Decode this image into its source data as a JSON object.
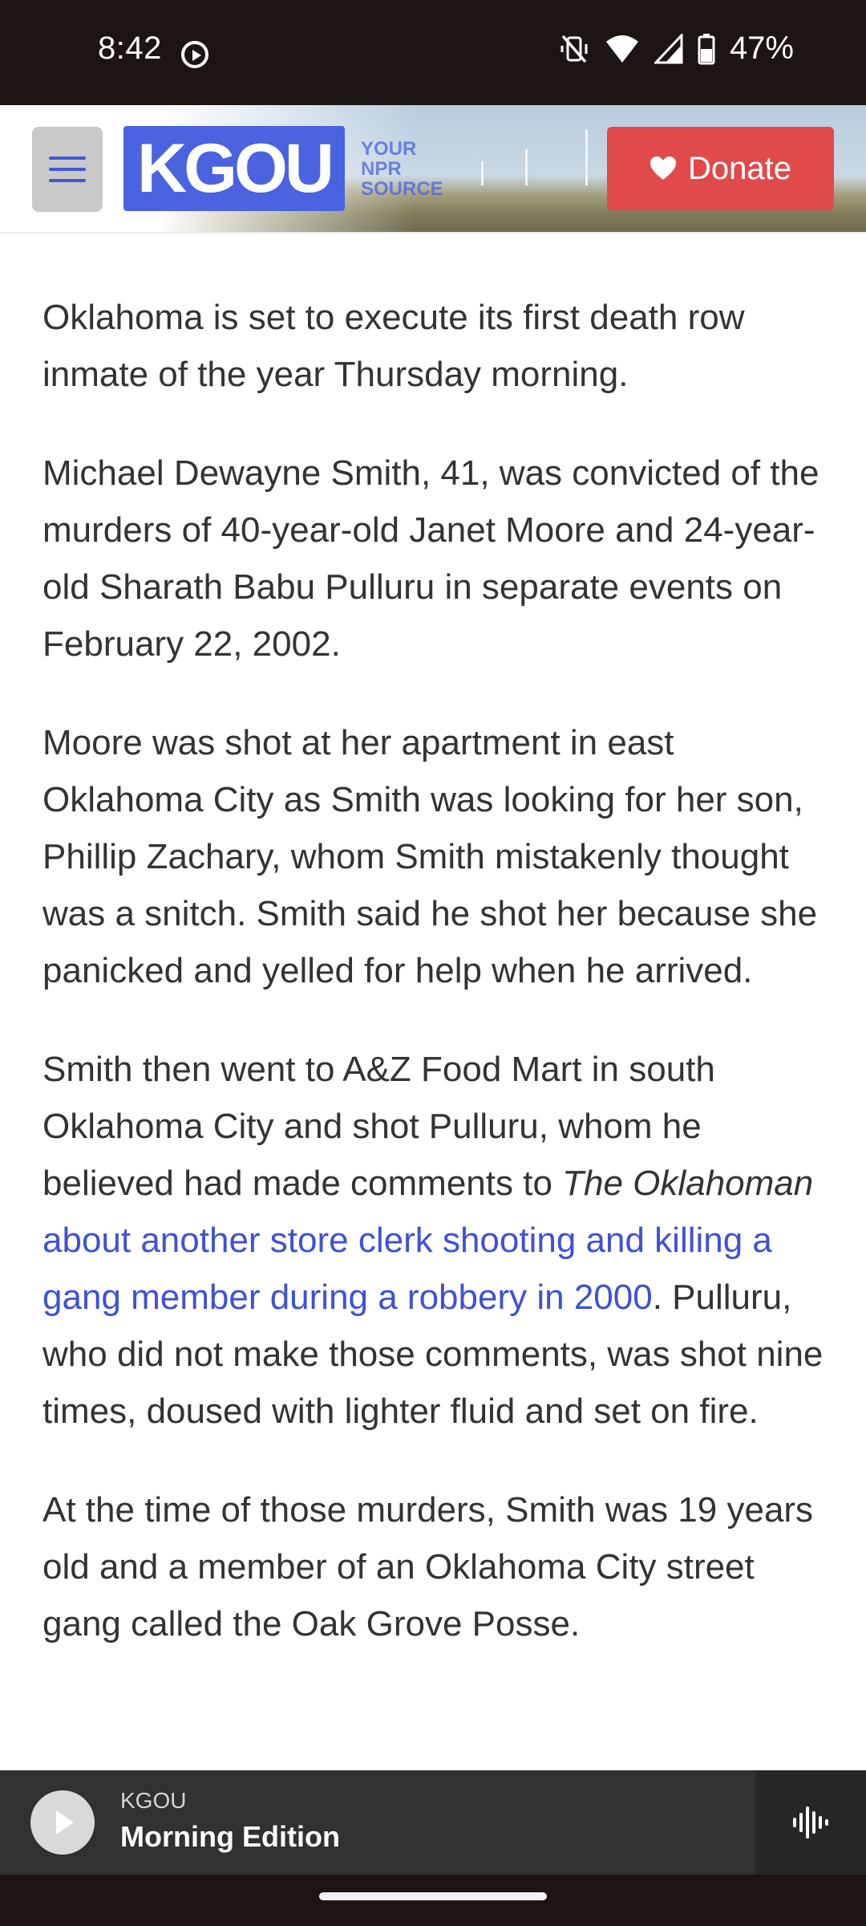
{
  "status_bar": {
    "time": "8:42",
    "battery": "47%",
    "icons": [
      "screen-record-icon",
      "mute-icon",
      "wifi-icon",
      "cell-signal-icon",
      "battery-icon"
    ]
  },
  "header": {
    "logo_text": "KGOU",
    "tagline_line1": "YOUR",
    "tagline_line2": "NPR",
    "tagline_line3": "SOURCE",
    "donate_label": "Donate",
    "accent_color": "#4a63e0",
    "donate_color": "#e04a4a"
  },
  "article": {
    "p1": "Oklahoma is set to execute its first death row inmate of the year Thursday morning.",
    "p2": "Michael Dewayne Smith, 41, was convicted of the murders of 40-year-old Janet Moore and 24-year-old Sharath Babu Pulluru in separate events on February 22, 2002.",
    "p3": "Moore was shot at her apartment in east Oklahoma City as Smith was looking for her son, Phillip Zachary, whom Smith mistakenly thought was a snitch. Smith said he shot her because she panicked and yelled for help when he arrived.",
    "p4_before": "Smith then went to A&Z Food Mart in south Oklahoma City and shot Pulluru, whom he believed had made comments to ",
    "p4_italic": "The Oklahoman",
    "p4_link": "about another store clerk shooting and killing a gang member during a robbery in 2000",
    "p4_after": ". Pulluru, who did not make those comments, was shot nine times, doused with lighter fluid and set on fire.",
    "p5": "At the time of those murders, Smith was 19 years old and a member of an Oklahoma City street gang called the Oak Grove Posse.",
    "link_color": "#3f51d4"
  },
  "player": {
    "station": "KGOU",
    "program": "Morning Edition"
  }
}
